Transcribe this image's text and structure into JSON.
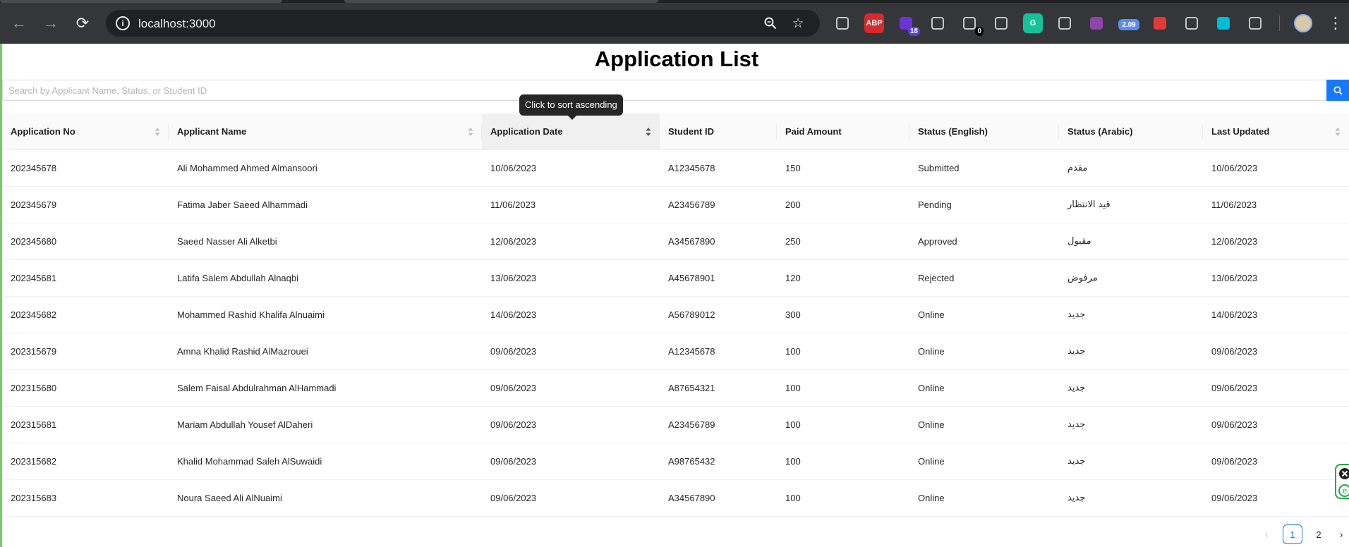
{
  "browser": {
    "url": "localhost:3000",
    "extensions": [
      {
        "name": "settings-gear-ext",
        "label": "",
        "color": "#5f6368"
      },
      {
        "name": "adblock-plus-ext",
        "label": "ABP",
        "color": "#d72a2a"
      },
      {
        "name": "graduation-cap-ext",
        "label": "",
        "color": "#6a34d6",
        "badge": "18"
      },
      {
        "name": "vue-devtools-ext",
        "label": "",
        "color": "#5f6368"
      },
      {
        "name": "counter-ext",
        "label": "",
        "color": "#5f6368",
        "badge": "0"
      },
      {
        "name": "camera-ext",
        "label": "",
        "color": "#5f6368"
      },
      {
        "name": "grammarly-ext",
        "label": "G",
        "color": "#15c39a"
      },
      {
        "name": "react-devtools-ext",
        "label": "",
        "color": "#5f6368"
      },
      {
        "name": "cube-ext",
        "label": "",
        "color": "#8e44ad"
      },
      {
        "name": "speed-ext",
        "label": "2.09",
        "color": "#5b8def"
      },
      {
        "name": "video-speed-ext",
        "label": "",
        "color": "#e53935"
      },
      {
        "name": "picture-in-picture-ext",
        "label": "",
        "color": "#5f6368"
      },
      {
        "name": "json-formatter-ext",
        "label": "",
        "color": "#00bcd4"
      },
      {
        "name": "extensions-puzzle-ext",
        "label": "",
        "color": "#5f6368"
      }
    ]
  },
  "page": {
    "title": "Application List",
    "search_placeholder": "Search by Applicant Name, Status, or Student ID",
    "tooltip": "Click to sort ascending"
  },
  "table": {
    "columns": [
      {
        "key": "app_no",
        "label": "Application No",
        "sortable": true
      },
      {
        "key": "name",
        "label": "Applicant Name",
        "sortable": true
      },
      {
        "key": "date",
        "label": "Application Date",
        "sortable": true
      },
      {
        "key": "student_id",
        "label": "Student ID",
        "sortable": false
      },
      {
        "key": "paid",
        "label": "Paid Amount",
        "sortable": false
      },
      {
        "key": "status_en",
        "label": "Status (English)",
        "sortable": false
      },
      {
        "key": "status_ar",
        "label": "Status (Arabic)",
        "sortable": false
      },
      {
        "key": "updated",
        "label": "Last Updated",
        "sortable": true
      }
    ],
    "rows": [
      [
        "202345678",
        "Ali Mohammed Ahmed Almansoori",
        "10/06/2023",
        "A12345678",
        "150",
        "Submitted",
        "مقدم",
        "10/06/2023"
      ],
      [
        "202345679",
        "Fatima Jaber Saeed Alhammadi",
        "11/06/2023",
        "A23456789",
        "200",
        "Pending",
        "قيد الانتظار",
        "11/06/2023"
      ],
      [
        "202345680",
        "Saeed Nasser Ali Alketbi",
        "12/06/2023",
        "A34567890",
        "250",
        "Approved",
        "مقبول",
        "12/06/2023"
      ],
      [
        "202345681",
        "Latifa Salem Abdullah Alnaqbi",
        "13/06/2023",
        "A45678901",
        "120",
        "Rejected",
        "مرفوض",
        "13/06/2023"
      ],
      [
        "202345682",
        "Mohammed Rashid Khalifa Alnuaimi",
        "14/06/2023",
        "A56789012",
        "300",
        "Online",
        "جديد",
        "14/06/2023"
      ],
      [
        "202315679",
        "Amna Khalid Rashid AlMazrouei",
        "09/06/2023",
        "A12345678",
        "100",
        "Online",
        "جديد",
        "09/06/2023"
      ],
      [
        "202315680",
        "Salem Faisal Abdulrahman AlHammadi",
        "09/06/2023",
        "A87654321",
        "100",
        "Online",
        "جديد",
        "09/06/2023"
      ],
      [
        "202315681",
        "Mariam Abdullah Yousef AlDaheri",
        "09/06/2023",
        "A23456789",
        "100",
        "Online",
        "جديد",
        "09/06/2023"
      ],
      [
        "202315682",
        "Khalid Mohammad Saleh AlSuwaidi",
        "09/06/2023",
        "A98765432",
        "100",
        "Online",
        "جديد",
        "09/06/2023"
      ],
      [
        "202315683",
        "Noura Saeed Ali AlNuaimi",
        "09/06/2023",
        "A34567890",
        "100",
        "Online",
        "جديد",
        "09/06/2023"
      ]
    ]
  },
  "pagination": {
    "prev": "‹",
    "pages": [
      "1",
      "2"
    ],
    "current": "1",
    "next": "›"
  },
  "colors": {
    "accent": "#1677ff",
    "page_border": "#7cc86f"
  }
}
